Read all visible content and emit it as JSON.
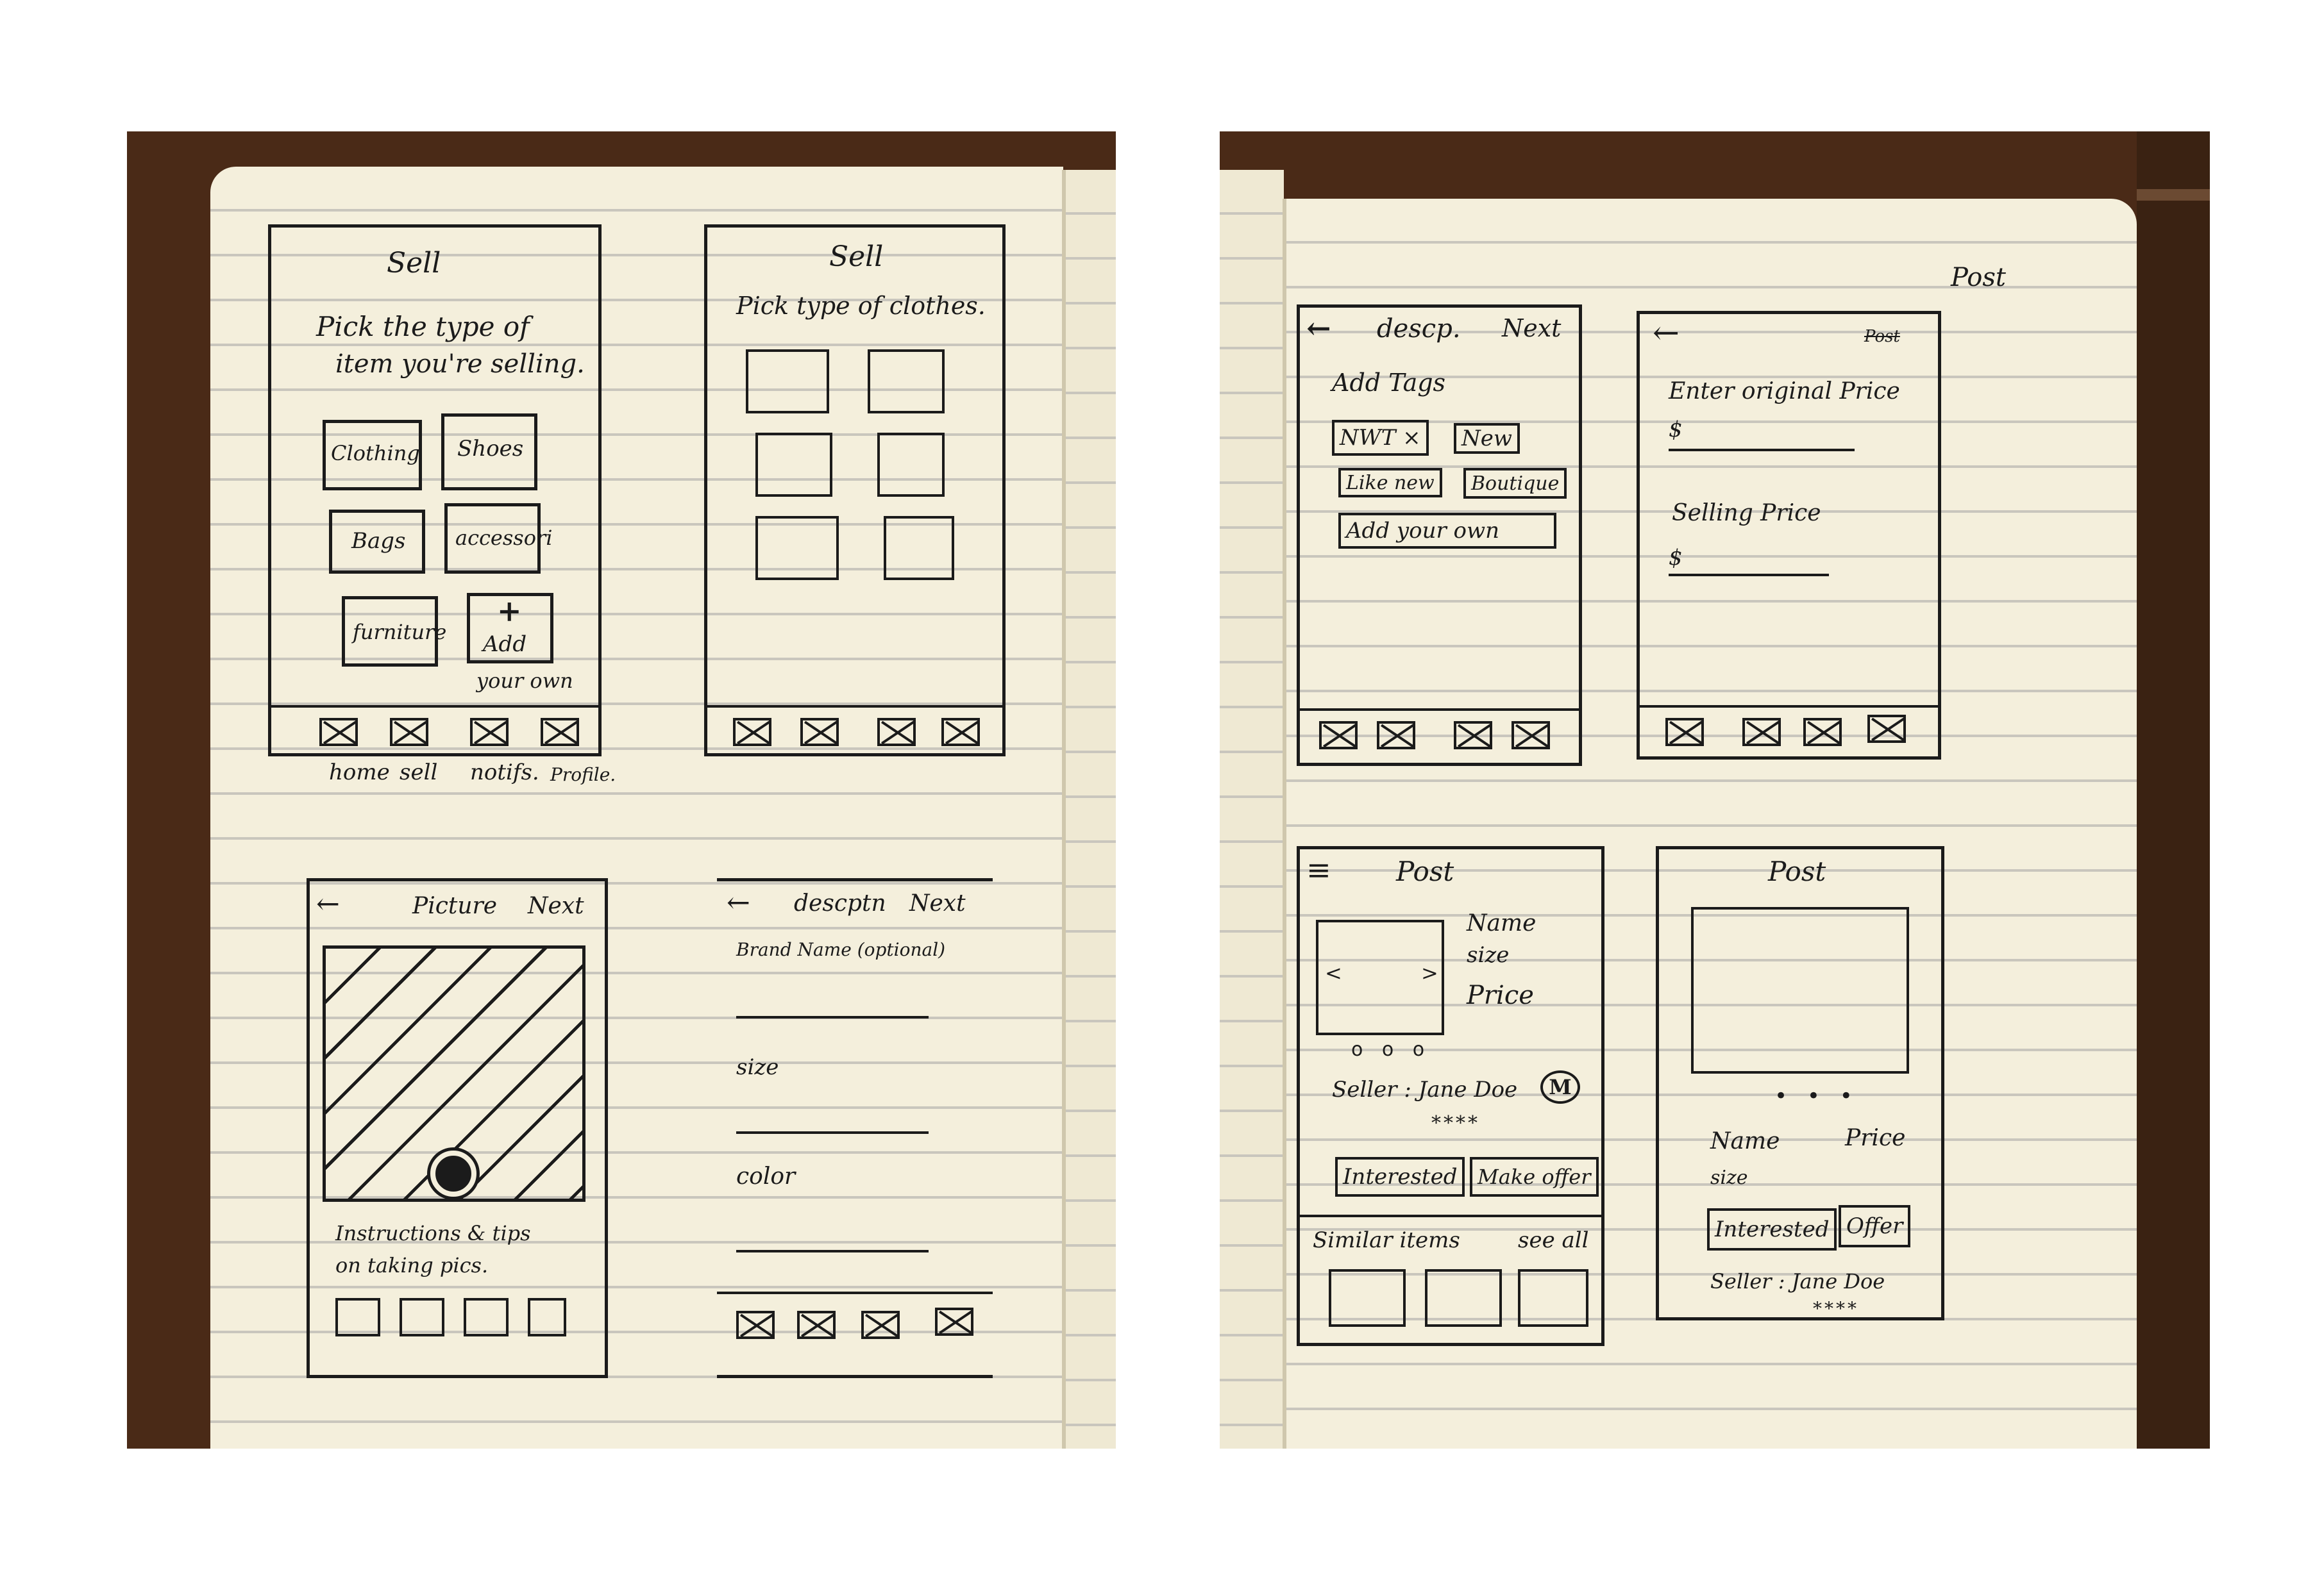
{
  "left_notebook": {
    "sketch1": {
      "title": "Sell",
      "prompt_line1": "Pick the type of",
      "prompt_line2": "item you're selling.",
      "categories": [
        "Clothing",
        "Shoes",
        "Bags",
        "accessori",
        "furniture",
        "Add"
      ],
      "add_plus": "+",
      "add_sub": "your own",
      "nav_labels": [
        "home",
        "sell",
        "notifs.",
        "Profile."
      ]
    },
    "sketch2": {
      "title": "Sell",
      "prompt": "Pick type of clothes."
    },
    "sketch3": {
      "back": "←",
      "title": "Picture",
      "next": "Next",
      "tip_line1": "Instructions & tips",
      "tip_line2": "on taking pics."
    },
    "sketch4": {
      "back": "←",
      "title": "descptn",
      "next": "Next",
      "field1": "Brand Name (optional)",
      "field2": "size",
      "field3": "color"
    }
  },
  "right_notebook": {
    "sketch5": {
      "back": "←",
      "title": "descp.",
      "next": "Next",
      "heading": "Add Tags",
      "tags": [
        "NWT ×",
        "New",
        "Like new",
        "Boutique",
        "Add your own"
      ]
    },
    "sketch6": {
      "top_label": "Post",
      "back": "←",
      "corner": "Post",
      "field1": "Enter original Price",
      "currency1": "$",
      "field2": "Selling Price",
      "currency2": "$"
    },
    "sketch7": {
      "menu": "≡",
      "title": "Post",
      "name": "Name",
      "size": "size",
      "price": "Price",
      "prev": "<",
      "next_arrow": ">",
      "carousel_dots": "o o o",
      "seller": "Seller : Jane Doe",
      "badge": "M",
      "stars": "****",
      "btn1": "Interested",
      "btn2": "Make offer",
      "similar": "Similar items",
      "see_all": "see all"
    },
    "sketch8": {
      "title": "Post",
      "carousel_dots": "• • •",
      "name": "Name",
      "price": "Price",
      "size": "size",
      "btn1": "Interested",
      "btn2": "Offer",
      "seller": "Seller : Jane Doe",
      "stars": "****"
    }
  }
}
